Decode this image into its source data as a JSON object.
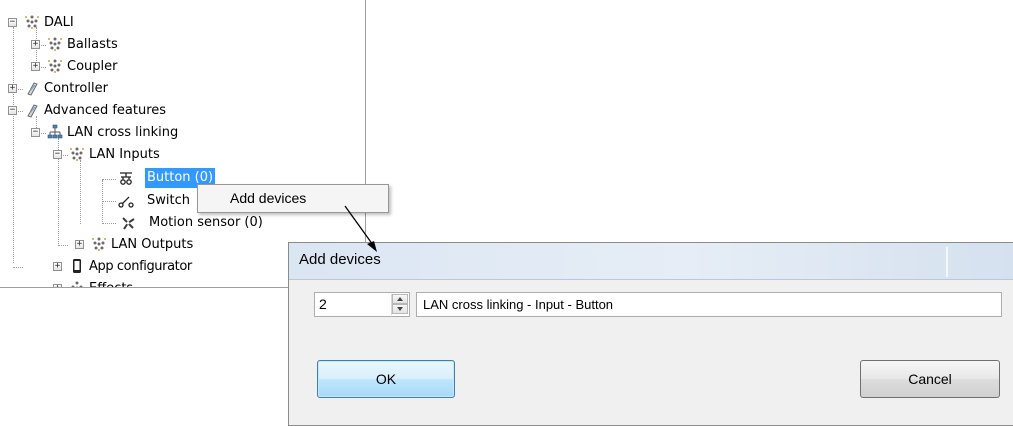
{
  "tree": {
    "items": [
      {
        "label": "DALI",
        "expander": "−",
        "icon": "asterisk-cluster-icon"
      },
      {
        "label": "Ballasts",
        "expander": "+",
        "icon": "asterisk-cluster-icon"
      },
      {
        "label": "Coupler",
        "expander": "+",
        "icon": "asterisk-cluster-icon"
      },
      {
        "label": "Controller",
        "expander": "+",
        "icon": "controller-icon"
      },
      {
        "label": "Advanced features",
        "expander": "−",
        "icon": "controller-icon"
      },
      {
        "label": "LAN cross linking",
        "expander": "−",
        "icon": "network-icon"
      },
      {
        "label": "LAN Inputs",
        "expander": "−",
        "icon": "asterisk-cluster-icon"
      },
      {
        "label": "Button (0)",
        "expander": "",
        "icon": "button-device-icon",
        "selected": true
      },
      {
        "label": "Switch",
        "expander": "",
        "icon": "switch-device-icon"
      },
      {
        "label": "Motion sensor (0)",
        "expander": "",
        "icon": "motion-sensor-icon"
      },
      {
        "label": "LAN Outputs",
        "expander": "+",
        "icon": "asterisk-cluster-icon"
      },
      {
        "label": "App configurator",
        "expander": "+",
        "icon": "phone-icon"
      },
      {
        "label": "Effects",
        "expander": "+",
        "icon": "asterisk-cluster-icon"
      }
    ]
  },
  "context_menu": {
    "items": [
      {
        "label": "Add devices"
      }
    ]
  },
  "dialog": {
    "title": "Add devices",
    "count_value": "2",
    "name_value": "LAN cross linking - Input - Button",
    "ok_label": "OK",
    "cancel_label": "Cancel"
  },
  "colors": {
    "selection": "#3399ff",
    "dialog_background": "#f0f0f0",
    "titlebar": "#dbe6f3",
    "ok_border": "#3c7fb1"
  }
}
